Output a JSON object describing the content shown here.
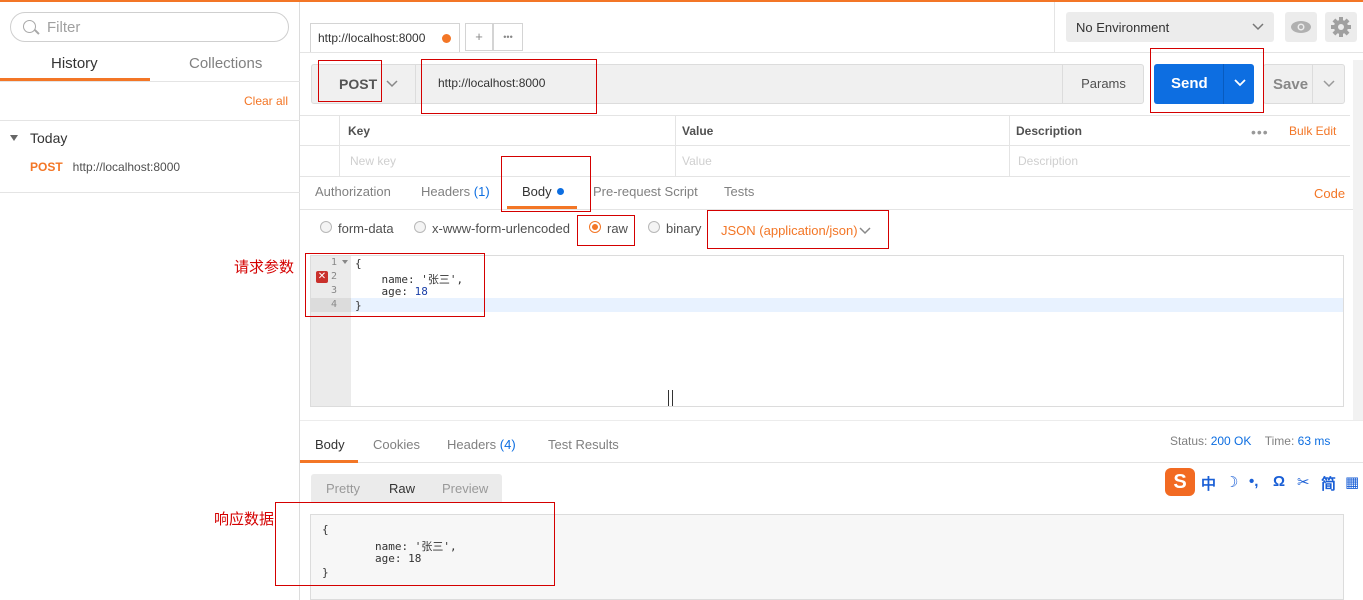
{
  "sidebar": {
    "filter_placeholder": "Filter",
    "tabs": [
      "History",
      "Collections"
    ],
    "clear_all": "Clear all",
    "group": "Today",
    "history": [
      {
        "method": "POST",
        "url": "http://localhost:8000"
      }
    ]
  },
  "topbar": {
    "tab_title": "http://localhost:8000",
    "add_tab": "+",
    "more": "•••",
    "environment": "No Environment"
  },
  "request": {
    "method": "POST",
    "url": "http://localhost:8000",
    "params": "Params",
    "send": "Send",
    "save": "Save"
  },
  "params_table": {
    "headers": [
      "Key",
      "Value",
      "Description"
    ],
    "placeholders": [
      "New key",
      "Value",
      "Description"
    ],
    "bulk_edit": "Bulk Edit",
    "more": "•••"
  },
  "request_tabs": {
    "authorization": "Authorization",
    "headers": "Headers",
    "headers_count": "(1)",
    "body": "Body",
    "prerequest": "Pre-request Script",
    "tests": "Tests",
    "code": "Code"
  },
  "body_types": {
    "options": [
      "form-data",
      "x-www-form-urlencoded",
      "raw",
      "binary"
    ],
    "selected": "raw",
    "content_type": "JSON (application/json)"
  },
  "editor": {
    "line_numbers": [
      "1",
      "2",
      "3",
      "4"
    ],
    "lines": [
      "{",
      "    name: '张三',",
      "    age: ",
      "}"
    ],
    "age_value": "18",
    "error_mark": "✕"
  },
  "response": {
    "tabs": {
      "body": "Body",
      "cookies": "Cookies",
      "headers": "Headers",
      "headers_count": "(4)",
      "test_results": "Test Results"
    },
    "status_label": "Status:",
    "status_value": "200 OK",
    "time_label": "Time:",
    "time_value": "63 ms",
    "formats": [
      "Pretty",
      "Raw",
      "Preview"
    ],
    "lines": [
      "{",
      "        name: '张三',",
      "        age: 18",
      "}"
    ]
  },
  "annotations": {
    "request_params": "请求参数",
    "response_data": "响应数据"
  },
  "ime": {
    "logo": "S",
    "glyphs": [
      "中",
      "☽",
      "•,",
      "Ω",
      "✂",
      "简",
      "▦"
    ]
  },
  "colors": {
    "accent": "#f37626",
    "send_blue": "#0d6ee1",
    "annotation_red": "#d40000"
  }
}
